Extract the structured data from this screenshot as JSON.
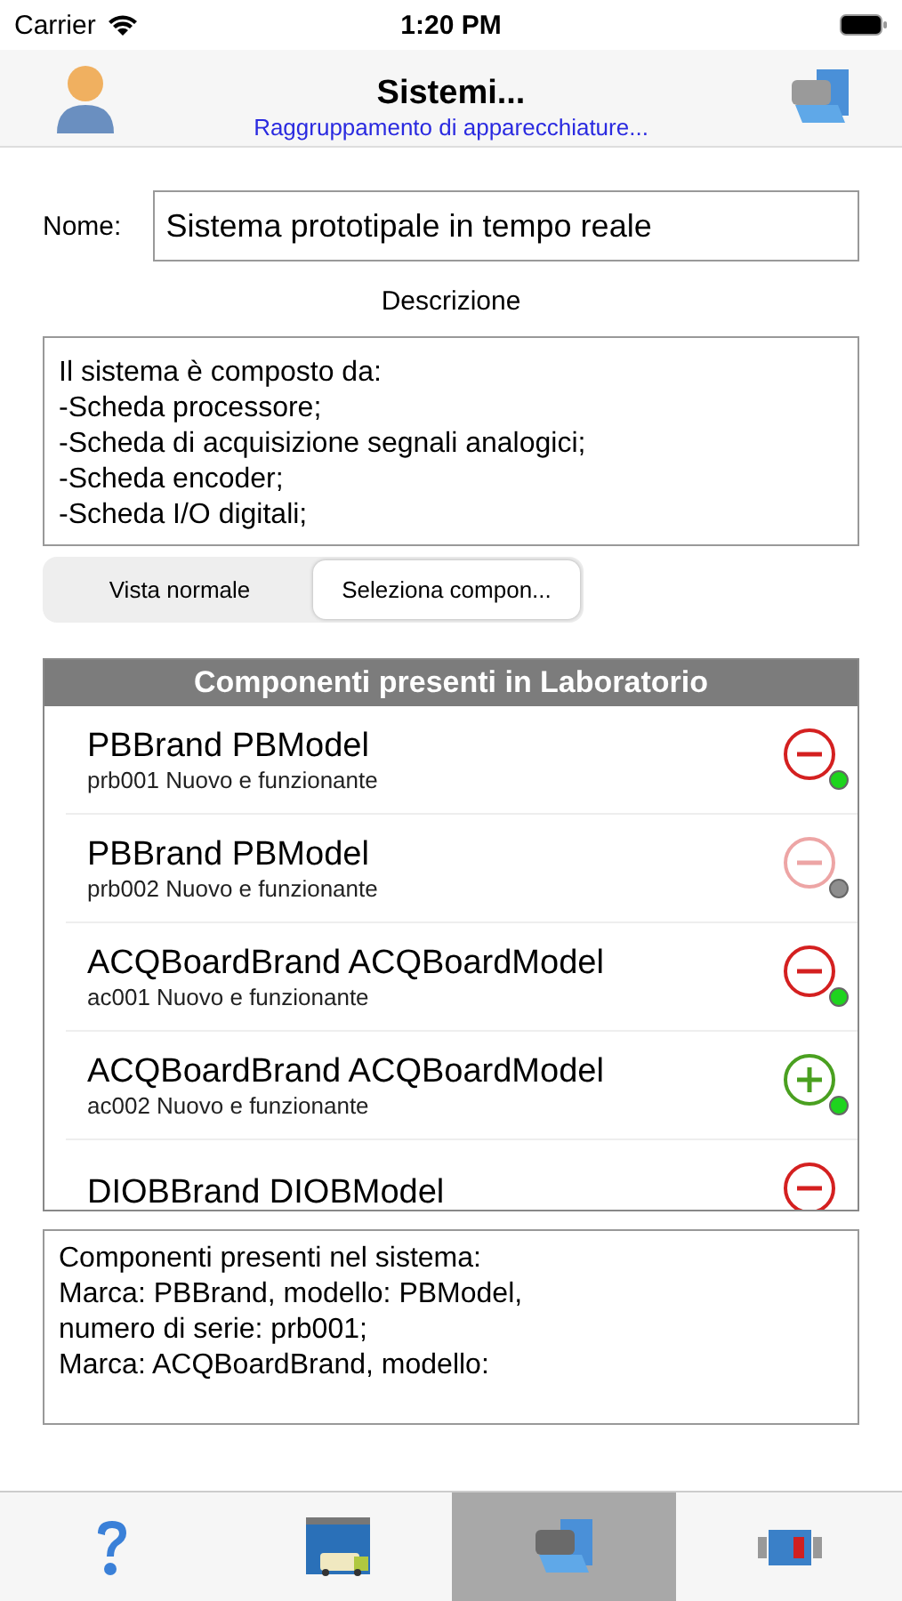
{
  "status_bar": {
    "carrier": "Carrier",
    "time": "1:20 PM"
  },
  "nav": {
    "title": "Sistemi...",
    "subtitle": "Raggruppamento di apparecchiature..."
  },
  "name_field": {
    "label": "Nome:",
    "value": "Sistema prototipale in tempo reale"
  },
  "description": {
    "label": "Descrizione",
    "lines": [
      "Il sistema è composto da:",
      "-Scheda processore;",
      "-Scheda di acquisizione segnali analogici;",
      "-Scheda encoder;",
      "-Scheda I/O digitali;"
    ]
  },
  "segments": [
    {
      "label": "Vista normale",
      "selected": false
    },
    {
      "label": "Seleziona compon...",
      "selected": true
    }
  ],
  "lab_list": {
    "header": "Componenti presenti in Laboratorio",
    "items": [
      {
        "title": "PBBrand PBModel",
        "subtitle": "prb001 Nuovo e funzionante",
        "kind": "remove",
        "disabled": false,
        "color": "#1ed41e"
      },
      {
        "title": "PBBrand PBModel",
        "subtitle": "prb002 Nuovo e funzionante",
        "kind": "remove",
        "disabled": true,
        "color": "#8e8e8e"
      },
      {
        "title": "ACQBoardBrand ACQBoardModel",
        "subtitle": "ac001 Nuovo e funzionante",
        "kind": "remove",
        "disabled": false,
        "color": "#1ed41e"
      },
      {
        "title": "ACQBoardBrand ACQBoardModel",
        "subtitle": "ac002 Nuovo e funzionante",
        "kind": "add",
        "disabled": false,
        "color": "#1ed41e"
      },
      {
        "title": "DIOBBrand DIOBModel",
        "kind": "remove",
        "disabled": false
      }
    ]
  },
  "system_box": {
    "lines": [
      "Componenti presenti nel sistema:",
      "Marca: PBBrand, modello: PBModel,",
      "numero di serie: prb001;",
      "Marca: ACQBoardBrand, modello:"
    ]
  },
  "tab_bar": [
    {
      "kind": "help",
      "selected": false
    },
    {
      "kind": "garage",
      "selected": false
    },
    {
      "kind": "machine",
      "selected": true
    },
    {
      "kind": "device",
      "selected": false
    }
  ]
}
